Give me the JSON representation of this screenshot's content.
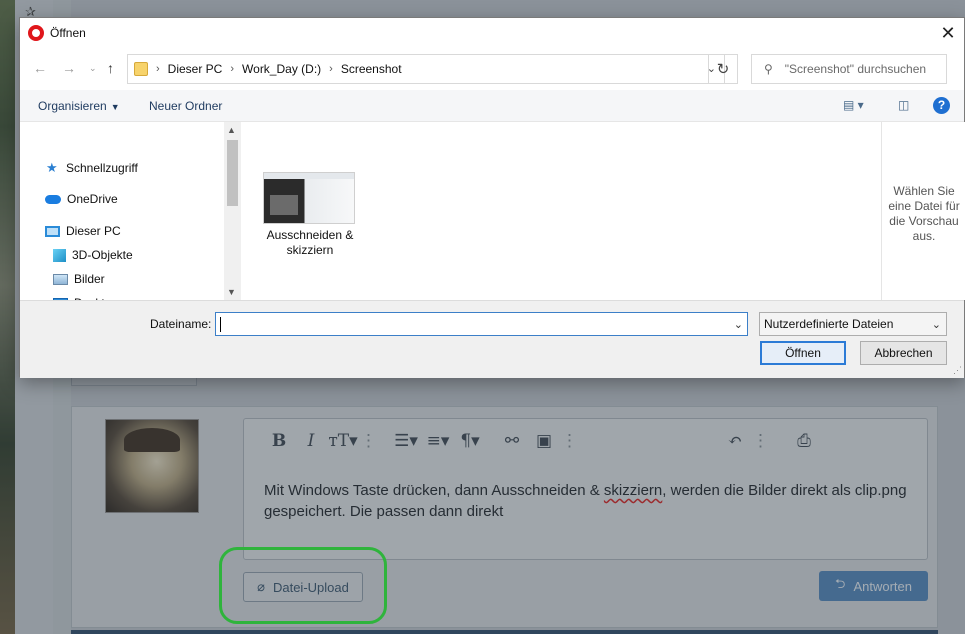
{
  "dialog": {
    "title": "Öffnen",
    "close": "✕",
    "breadcrumb": [
      "Dieser PC",
      "Work_Day (D:)",
      "Screenshot"
    ],
    "search_placeholder": "\"Screenshot\" durchsuchen",
    "commands": {
      "organize": "Organisieren",
      "new_folder": "Neuer Ordner"
    },
    "tree": [
      "Schnellzugriff",
      "OneDrive",
      "Dieser PC",
      "3D-Objekte",
      "Bilder",
      "Desktop"
    ],
    "files": [
      {
        "name": "Ausschneiden & skizziern"
      }
    ],
    "preview_text": "Wählen Sie eine Datei für die Vorschau aus.",
    "filename_label": "Dateiname:",
    "filename_value": "",
    "filetype": "Nutzerdefinierte Dateien",
    "open_button": "Öffnen",
    "cancel_button": "Abbrechen"
  },
  "editor": {
    "text_part1": "Mit Windows Taste drücken, dann Ausschneiden & ",
    "text_misspelled": "skizziern",
    "text_part2": ", werden die Bilder direkt als clip.png gespeichert. Die passen dann direkt",
    "upload_label": "Datei-Upload",
    "reply_label": "Antworten"
  },
  "colors": {
    "accent": "#2c7bd6",
    "highlight": "#2fb43c",
    "reply": "#5d8fc2"
  }
}
